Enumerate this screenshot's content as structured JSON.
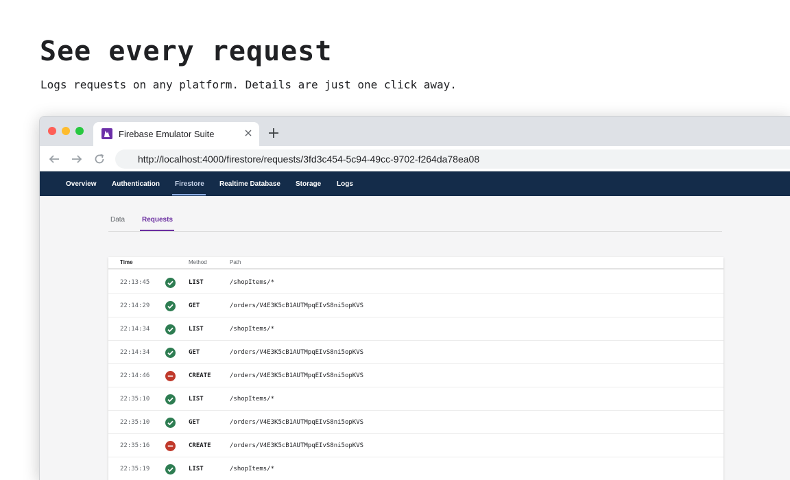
{
  "hero": {
    "title": "See every request",
    "subtitle": "Logs requests on any platform. Details are just one click away."
  },
  "browser": {
    "tab_title": "Firebase Emulator Suite",
    "url": "http://localhost:4000/firestore/requests/3fd3c454-5c94-49cc-9702-f264da78ea08"
  },
  "appnav": {
    "items": [
      "Overview",
      "Authentication",
      "Firestore",
      "Realtime Database",
      "Storage",
      "Logs"
    ],
    "active": "Firestore"
  },
  "subtabs": {
    "data_label": "Data",
    "requests_label": "Requests"
  },
  "table": {
    "headers": {
      "time": "Time",
      "method": "Method",
      "path": "Path"
    },
    "rows": [
      {
        "time": "22:13:45",
        "status": "success",
        "method": "LIST",
        "path": "/shopItems/*"
      },
      {
        "time": "22:14:29",
        "status": "success",
        "method": "GET",
        "path": "/orders/V4E3K5cB1AUTMpqEIvS8ni5opKVS"
      },
      {
        "time": "22:14:34",
        "status": "success",
        "method": "LIST",
        "path": "/shopItems/*"
      },
      {
        "time": "22:14:34",
        "status": "success",
        "method": "GET",
        "path": "/orders/V4E3K5cB1AUTMpqEIvS8ni5opKVS"
      },
      {
        "time": "22:14:46",
        "status": "denied",
        "method": "CREATE",
        "path": "/orders/V4E3K5cB1AUTMpqEIvS8ni5opKVS"
      },
      {
        "time": "22:35:10",
        "status": "success",
        "method": "LIST",
        "path": "/shopItems/*"
      },
      {
        "time": "22:35:10",
        "status": "success",
        "method": "GET",
        "path": "/orders/V4E3K5cB1AUTMpqEIvS8ni5opKVS"
      },
      {
        "time": "22:35:16",
        "status": "denied",
        "method": "CREATE",
        "path": "/orders/V4E3K5cB1AUTMpqEIvS8ni5opKVS"
      },
      {
        "time": "22:35:19",
        "status": "success",
        "method": "LIST",
        "path": "/shopItems/*"
      }
    ]
  },
  "colors": {
    "success": "#2e7d52",
    "denied": "#c0392b",
    "nav_bg": "#142c4a",
    "accent": "#6a2ea0"
  },
  "icons": {
    "success": "check-circle-icon",
    "denied": "minus-circle-icon"
  }
}
